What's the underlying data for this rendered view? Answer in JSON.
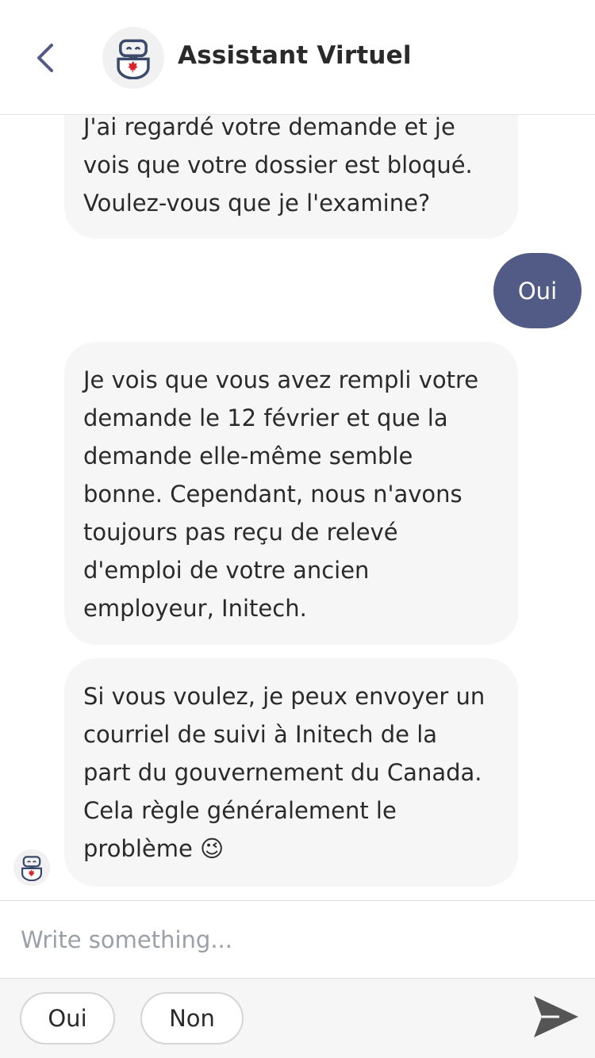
{
  "header": {
    "title": "Assistant Virtuel",
    "back_icon": "chevron-left-icon",
    "avatar_icon": "robot-maple-leaf-icon"
  },
  "messages": [
    {
      "from": "bot",
      "text": "J'ai regardé votre demande et je\nvois que votre dossier est bloqué.\nVoulez-vous que je l'examine?"
    },
    {
      "from": "user",
      "text": "Oui"
    },
    {
      "from": "bot",
      "text": "Je vois que vous avez rempli votre\ndemande le 12 février et que la\ndemande elle-même semble\nbonne. Cependant, nous n'avons\ntoujours pas reçu de relevé\nd'emploi de votre ancien\nemployeur, Initech."
    },
    {
      "from": "bot",
      "text": "Si vous voulez, je peux envoyer un\ncourriel de suivi à Initech de la\npart du gouvernement du Canada.\nCela règle généralement le\nproblème 😉"
    }
  ],
  "composer": {
    "placeholder": "Write something..."
  },
  "quick_replies": [
    "Oui",
    "Non"
  ],
  "send_icon": "send-arrow-icon",
  "colors": {
    "accent": "#515b86",
    "bubble_bot": "#f6f6f6",
    "back_arrow": "#515b86",
    "send_icon": "#555555"
  }
}
